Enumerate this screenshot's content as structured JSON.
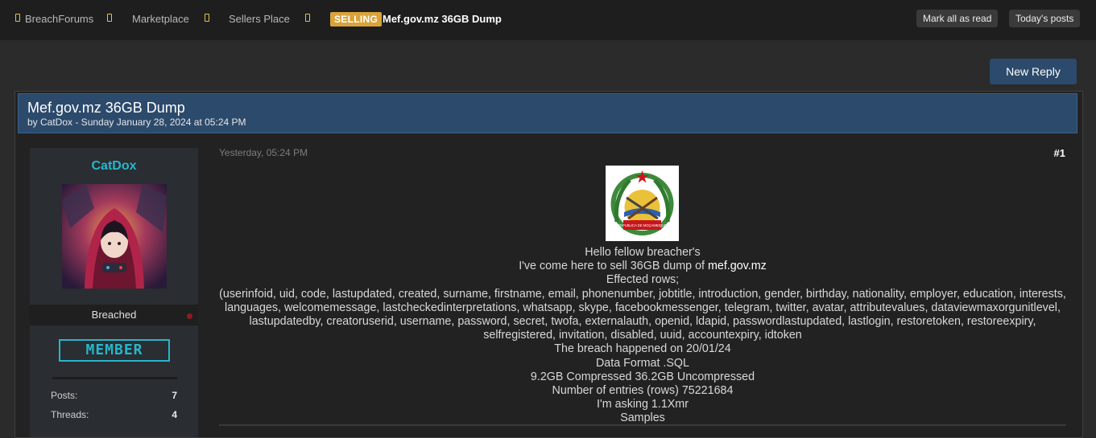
{
  "nav": {
    "breadcrumbs": [
      "BreachForums",
      "Marketplace",
      "Sellers Place"
    ],
    "prefix_tag": "SELLING",
    "current": "Mef.gov.mz 36GB Dump",
    "mark_read_label": "Mark all as read",
    "todays_posts_label": "Today's posts"
  },
  "actions": {
    "new_reply_label": "New Reply"
  },
  "thread": {
    "title": "Mef.gov.mz 36GB Dump",
    "meta": "by CatDox - Sunday January 28, 2024 at 05:24 PM"
  },
  "user": {
    "name": "CatDox",
    "status": "Breached",
    "rank_badge": "MEMBER",
    "stats": [
      {
        "label": "Posts:",
        "value": "7"
      },
      {
        "label": "Threads:",
        "value": "4"
      }
    ]
  },
  "post": {
    "date": "Yesterday, 05:24 PM",
    "number": "#1",
    "emblem_text": "REPUBLICA DE MOÇAMBIQUE",
    "line1": "Hello fellow breacher's",
    "line2_prefix": "I've come here to sell 36GB dump of ",
    "line2_domain": "mef.gov.mz",
    "line3": "Effected rows;",
    "line4": "(userinfoid, uid, code, lastupdated, created, surname, firstname, email, phonenumber, jobtitle, introduction, gender, birthday, nationality, employer, education, interests, languages, welcomemessage, lastcheckedinterpretations, whatsapp, skype, facebookmessenger, telegram, twitter, avatar, attributevalues, dataviewmaxorgunitlevel, lastupdatedby, creatoruserid, username, password, secret, twofa, externalauth, openid, ldapid, passwordlastupdated, lastlogin, restoretoken, restoreexpiry, selfregistered, invitation, disabled, uuid, accountexpiry, idtoken",
    "line5": "The breach happened on 20/01/24",
    "line6": "Data Format .SQL",
    "line7": "9.2GB Compressed 36.2GB Uncompressed",
    "line8": "Number of entries (rows) 75221684",
    "line9": "I'm asking 1.1Xmr",
    "line10": "Samples"
  },
  "colors": {
    "accent_blue": "#2c4a6b",
    "username_cyan": "#26b7cc",
    "selling_tag": "#d9a33a",
    "nav_separator": "#e0c34a"
  }
}
